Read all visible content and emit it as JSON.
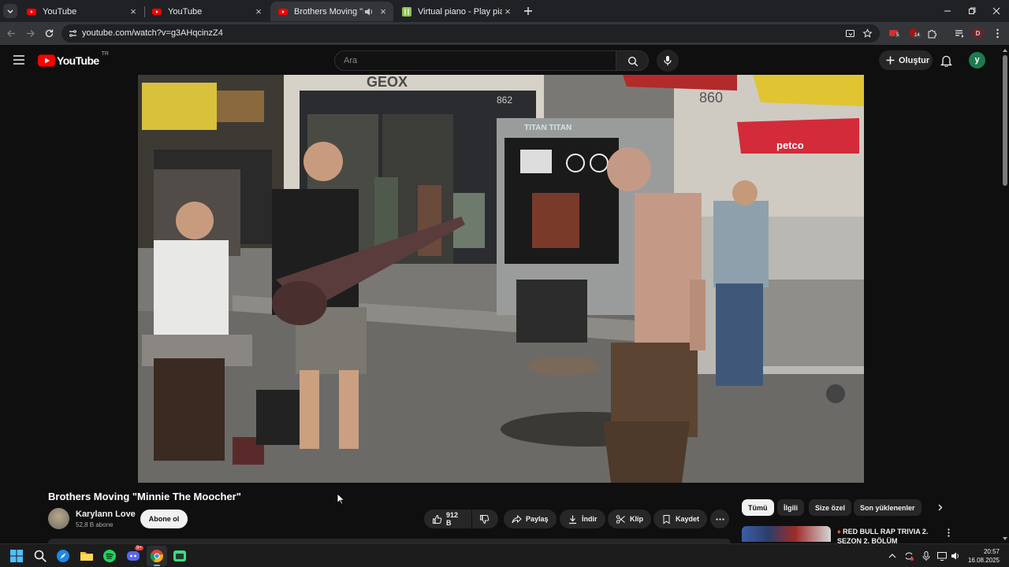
{
  "browser": {
    "tabs": [
      {
        "title": "YouTube",
        "active": false
      },
      {
        "title": "YouTube",
        "active": false
      },
      {
        "title": "Brothers Moving \"Minnie Th",
        "active": true,
        "audio": true
      },
      {
        "title": "Virtual piano - Play piano onlin",
        "active": false
      }
    ],
    "url": "youtube.com/watch?v=g3AHqcinzZ4",
    "ext_badges": [
      "5",
      "14"
    ],
    "profile_letter": "D"
  },
  "youtube": {
    "logo_text": "YouTube",
    "region": "TR",
    "search_placeholder": "Ara",
    "create_label": "Oluştur",
    "avatar_letter": "y"
  },
  "video": {
    "title": "Brothers Moving \"Minnie The Moocher\"",
    "channel": "Karylann Love",
    "subscribers": "52,8 B abone",
    "subscribe_label": "Abone ol",
    "likes": "912 B",
    "share_label": "Paylaş",
    "download_label": "İndir",
    "clip_label": "Klip",
    "save_label": "Kaydet",
    "scene_signs": {
      "store": "GEOX",
      "number_left": "862",
      "number_right": "860",
      "shop": "petco",
      "kiosk": "TITAN"
    }
  },
  "recommendations": {
    "chips": [
      "Tümü",
      "İlgili",
      "Size özel",
      "Son yüklenenler"
    ],
    "first_title": "RED BULL RAP TRIVIA 2. SEZON 2. BÖLÜM"
  },
  "taskbar": {
    "time": "20:57",
    "date": "16.08.2025",
    "discord_badge": "9+"
  },
  "colors": {
    "youtube_red": "#ff0000",
    "bg": "#0f0f0f",
    "chip": "#272727",
    "avatar": "#1e7a4f"
  }
}
